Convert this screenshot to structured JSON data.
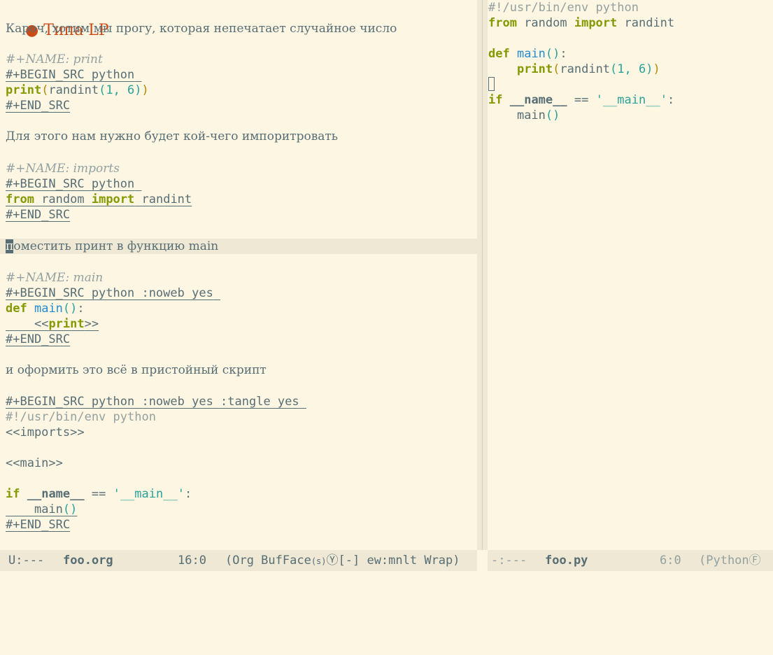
{
  "left": {
    "title_bullet": "●",
    "title": "Типа LP",
    "intro": "Кароч, хотим мы прогу, которая непечатает случайное число",
    "block1": {
      "name": "#+NAME: print",
      "begin": "#+BEGIN_SRC python",
      "code_fn": "print",
      "code_open": "(",
      "code_call": "randint",
      "code_open2": "(",
      "code_args": "1, 6",
      "code_close2": ")",
      "code_close": ")",
      "end": "#+END_SRC"
    },
    "text2": "Для этого нам нужно будет кой-чего импоритровать",
    "block2": {
      "name": "#+NAME: imports",
      "begin": "#+BEGIN_SRC python",
      "kw_from": "from",
      "mod": " random ",
      "kw_import": "import",
      "rest": " randint",
      "end": "#+END_SRC"
    },
    "text3_cursor": "п",
    "text3": "оместить принт в функцию main",
    "block3": {
      "name": "#+NAME: main",
      "begin": "#+BEGIN_SRC python :noweb yes",
      "kw_def": "def",
      "fn_main": "main",
      "parens": "()",
      "colon": ":",
      "indent": "    ",
      "noweb_open": "<<",
      "noweb_print": "print",
      "noweb_close": ">>",
      "end": "#+END_SRC"
    },
    "text4": "и оформить это всё в пристойный скрипт",
    "block4": {
      "begin": "#+BEGIN_SRC python :noweb yes :tangle yes",
      "shebang": "#!/usr/bin/env python",
      "imports": "<<imports>>",
      "main_ref": "<<main>>",
      "kw_if": "if",
      "dunder": "__name__",
      "eq": " == ",
      "str": "'__main__'",
      "colon": ":",
      "indent": "    ",
      "call": "main",
      "call_parens": "()",
      "end": "#+END_SRC"
    }
  },
  "right": {
    "shebang": "#!/usr/bin/env python",
    "kw_from": "from",
    "mod": " random ",
    "kw_import": "import",
    "rest": " randint",
    "kw_def": "def",
    "fn_main": "main",
    "parens": "()",
    "colon": ":",
    "indent": "    ",
    "print_fn": "print",
    "paren_open": "(",
    "randint": "randint",
    "paren_open2": "(",
    "args": "1, 6",
    "paren_close2": ")",
    "paren_close": ")",
    "kw_if": "if",
    "dunder": "__name__",
    "eq": " == ",
    "str": "'__main__'",
    "colon2": ":",
    "call": "main",
    "call_parens": "()"
  },
  "modeline_left": {
    "state": "U:---",
    "buffer": "foo.org",
    "position": "16:0",
    "modes": "(Org BufFace",
    "modes_s": "(s)",
    "modes_y": "Ⓨ",
    "modes_rest": "[-] ew:mnlt Wrap)"
  },
  "modeline_right": {
    "state": "-:---",
    "buffer": "foo.py",
    "position": "6:0",
    "modes": "(Python",
    "modes_f": "Ⓕ"
  },
  "colors": {
    "background": "#fdf6e3",
    "foreground": "#586e75",
    "keyword": "#859900",
    "function": "#268bd2",
    "string": "#2aa198",
    "title": "#cb4b16",
    "comment": "#93a1a1",
    "modeline": "#eee8d5"
  }
}
